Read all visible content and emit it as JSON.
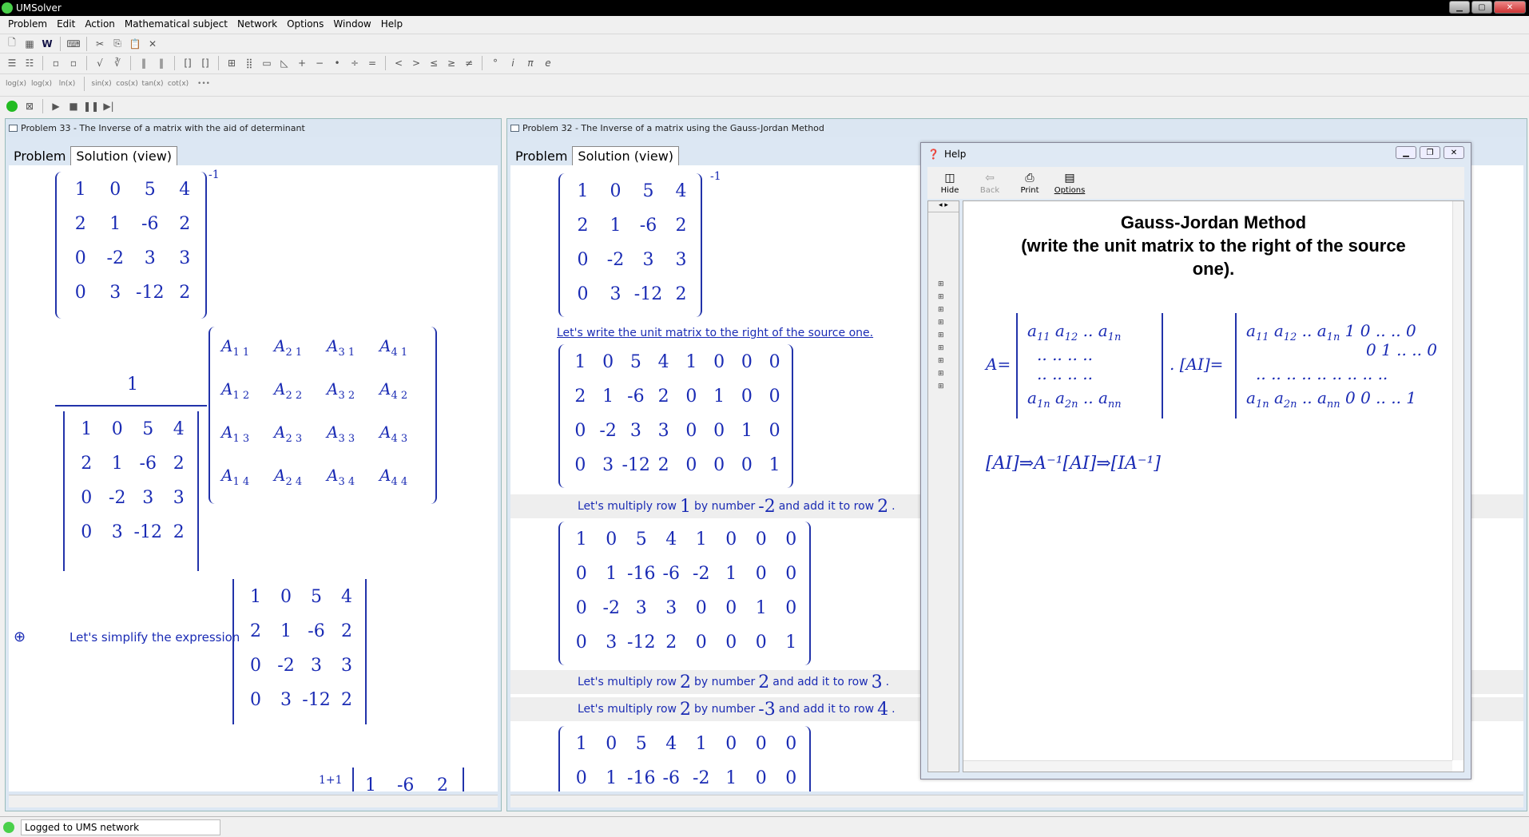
{
  "window": {
    "title": "UMSolver"
  },
  "menu": [
    "Problem",
    "Edit",
    "Action",
    "Mathematical subject",
    "Network",
    "Options",
    "Window",
    "Help"
  ],
  "toolbar3": [
    "log(x)",
    "log(x)",
    "ln(x)",
    "sin(x)",
    "cos(x)",
    "tan(x)",
    "cot(x)",
    "•••"
  ],
  "panel_left": {
    "title": "Problem 33 - The Inverse of a matrix with the aid of determinant",
    "tabs": [
      "Problem",
      "Solution (view)"
    ],
    "matrix": [
      [
        "1",
        "0",
        "5",
        "4"
      ],
      [
        "2",
        "1",
        "-6",
        "2"
      ],
      [
        "0",
        "-2",
        "3",
        "3"
      ],
      [
        "0",
        "3",
        "-12",
        "2"
      ]
    ],
    "inverse_sup": "-1",
    "fraction_numerator": "1",
    "cofactor_rows": [
      [
        "A1 1",
        "A2 1",
        "A3 1",
        "A4 1"
      ],
      [
        "A1 2",
        "A2 2",
        "A3 2",
        "A4 2"
      ],
      [
        "A1 3",
        "A2 3",
        "A3 3",
        "A4 3"
      ],
      [
        "A1 4",
        "A2 4",
        "A3 4",
        "A4 4"
      ]
    ],
    "simplify_label": "Let's simplify the expression",
    "bottom_partial": {
      "sup": "1+1",
      "row": [
        "1",
        "-6",
        "2"
      ]
    }
  },
  "panel_right": {
    "title": "Problem 32 - The Inverse of a matrix using the Gauss-Jordan Method",
    "tabs": [
      "Problem",
      "Solution (view)"
    ],
    "matrix": [
      [
        "1",
        "0",
        "5",
        "4"
      ],
      [
        "2",
        "1",
        "-6",
        "2"
      ],
      [
        "0",
        "-2",
        "3",
        "3"
      ],
      [
        "0",
        "3",
        "-12",
        "2"
      ]
    ],
    "inverse_sup": "-1",
    "link_text": "Let's write the unit matrix to the right of the source one.",
    "aug1": [
      [
        "1",
        "0",
        "5",
        "4",
        "1",
        "0",
        "0",
        "0"
      ],
      [
        "2",
        "1",
        "-6",
        "2",
        "0",
        "1",
        "0",
        "0"
      ],
      [
        "0",
        "-2",
        "3",
        "3",
        "0",
        "0",
        "1",
        "0"
      ],
      [
        "0",
        "3",
        "-12",
        "2",
        "0",
        "0",
        "0",
        "1"
      ]
    ],
    "step1": {
      "a": "Let's multiply row",
      "r": "1",
      "b": "by number",
      "n": "-2",
      "c": "and add it to row",
      "t": "2"
    },
    "aug2": [
      [
        "1",
        "0",
        "5",
        "4",
        "1",
        "0",
        "0",
        "0"
      ],
      [
        "0",
        "1",
        "-16",
        "-6",
        "-2",
        "1",
        "0",
        "0"
      ],
      [
        "0",
        "-2",
        "3",
        "3",
        "0",
        "0",
        "1",
        "0"
      ],
      [
        "0",
        "3",
        "-12",
        "2",
        "0",
        "0",
        "0",
        "1"
      ]
    ],
    "step2": {
      "a": "Let's multiply row",
      "r": "2",
      "b": "by number",
      "n": "2",
      "c": "and add it to row",
      "t": "3"
    },
    "step3": {
      "a": "Let's multiply row",
      "r": "2",
      "b": "by number",
      "n": "-3",
      "c": "and add it to row",
      "t": "4"
    },
    "aug3": [
      [
        "1",
        "0",
        "5",
        "4",
        "1",
        "0",
        "0",
        "0"
      ],
      [
        "0",
        "1",
        "-16",
        "-6",
        "-2",
        "1",
        "0",
        "0"
      ]
    ]
  },
  "help": {
    "title": "Help",
    "buttons": [
      "Hide",
      "Back",
      "Print",
      "Options"
    ],
    "heading": [
      "Gauss-Jordan Method",
      "(write the unit matrix to the right of the source",
      "one)."
    ],
    "formula": "[AI]⇒A⁻¹[AI]⇒[IA⁻¹]"
  },
  "status": {
    "text": "Logged to UMS network"
  }
}
